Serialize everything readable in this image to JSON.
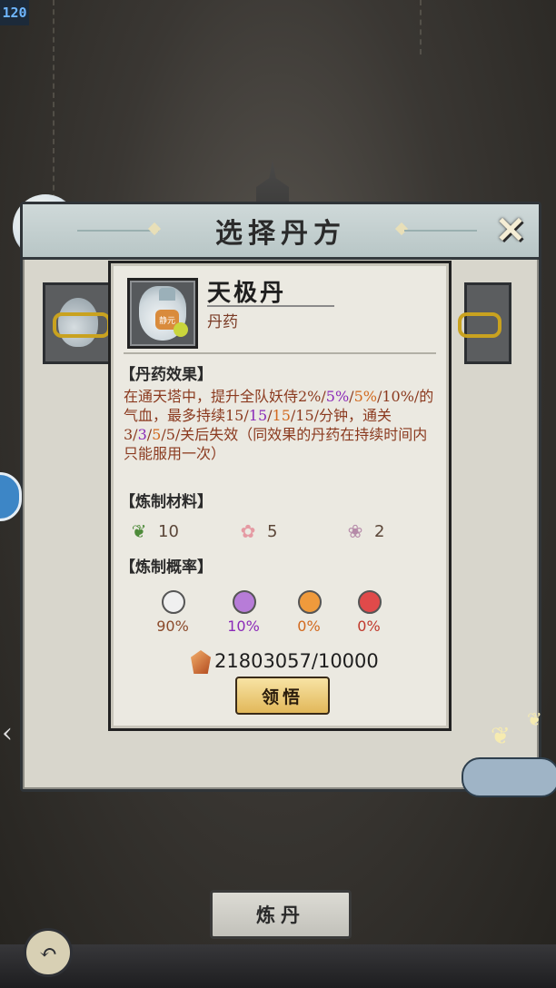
{
  "fps": "120",
  "dialog": {
    "title": "选择丹方",
    "close_glyph": "✕"
  },
  "popup": {
    "item_name": "天极丹",
    "item_type": "丹药",
    "bottle_text": "静元",
    "effect_title": "【丹药效果】",
    "effect_segments": [
      {
        "text": "在通天塔中，提升全队妖侍2%/",
        "color": "default"
      },
      {
        "text": "5%",
        "color": "purple"
      },
      {
        "text": "/",
        "color": "default"
      },
      {
        "text": "5%",
        "color": "orange"
      },
      {
        "text": "/10%/的气血，最多持续15/",
        "color": "default"
      },
      {
        "text": "15",
        "color": "purple"
      },
      {
        "text": "/",
        "color": "default"
      },
      {
        "text": "15",
        "color": "orange"
      },
      {
        "text": "/15/分钟，通关3/",
        "color": "default"
      },
      {
        "text": "3",
        "color": "purple"
      },
      {
        "text": "/",
        "color": "default"
      },
      {
        "text": "5",
        "color": "orange"
      },
      {
        "text": "/5/关后失效（同效果的丹药在持续时间内只能服用一次）",
        "color": "default"
      }
    ],
    "materials_title": "【炼制材料】",
    "materials": [
      {
        "icon": "herb-leaf-icon",
        "count": "10"
      },
      {
        "icon": "peach-blossom-icon",
        "count": "5"
      },
      {
        "icon": "flower-sprig-icon",
        "count": "2"
      }
    ],
    "rate_title": "【炼制概率】",
    "rates": [
      {
        "color": "#f0f0f0",
        "value": "90%",
        "text_color": "#8b4a2b"
      },
      {
        "color": "#b77cd8",
        "value": "10%",
        "text_color": "#8b2bb8"
      },
      {
        "color": "#ef9a3c",
        "value": "0%",
        "text_color": "#d2691e"
      },
      {
        "color": "#e04a4a",
        "value": "0%",
        "text_color": "#c0392b"
      }
    ],
    "cost": "21803057/10000",
    "learn_label": "领悟"
  },
  "footer": {
    "refine_label": "炼丹",
    "back_glyph": "↶"
  },
  "colors": {
    "default_text": "#8b3a1f",
    "purple": "#8b2bb8",
    "orange": "#d2691e"
  }
}
